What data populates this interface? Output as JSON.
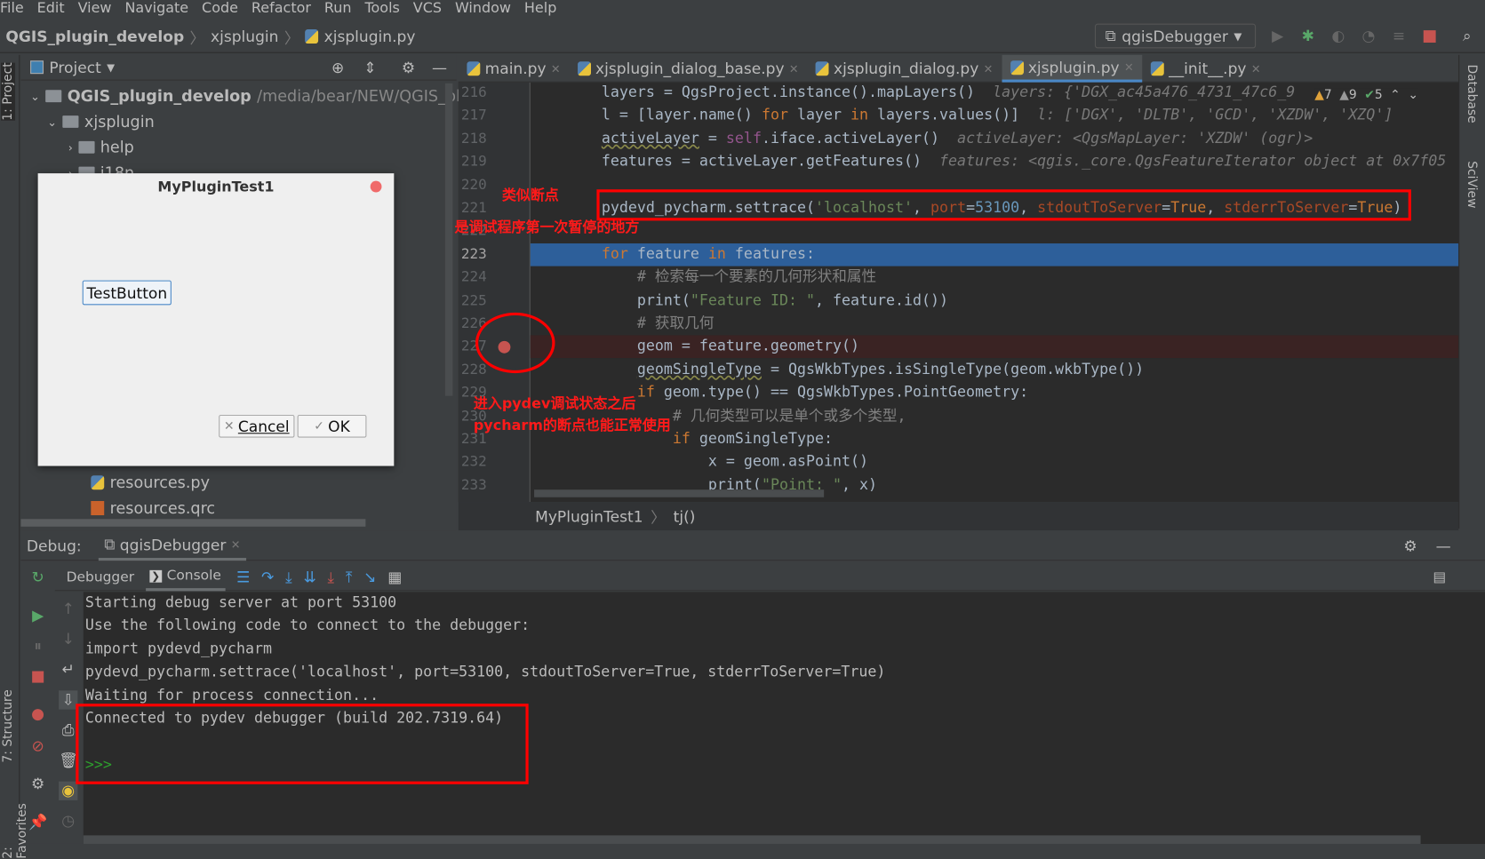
{
  "menu": [
    "File",
    "Edit",
    "View",
    "Navigate",
    "Code",
    "Refactor",
    "Run",
    "Tools",
    "VCS",
    "Window",
    "Help"
  ],
  "breadcrumb": {
    "project": "QGIS_plugin_develop",
    "folder": "xjsplugin",
    "file": "xjsplugin.py"
  },
  "run_config": "qgisDebugger",
  "left_strip": {
    "project": "1: Project",
    "structure": "7: Structure",
    "favorites": "2: Favorites"
  },
  "right_strip": {
    "database": "Database",
    "sciview": "SciView"
  },
  "project_panel": {
    "title": "Project",
    "root": "QGIS_plugin_develop",
    "root_path": "/media/bear/NEW/QGIS_plugi",
    "items": [
      "xjsplugin",
      "help",
      "i18n",
      "resources.py",
      "resources.qrc"
    ]
  },
  "dialog": {
    "title": "MyPluginTest1",
    "test_button": "TestButton",
    "cancel": "Cancel",
    "ok": "OK"
  },
  "tabs": [
    {
      "label": "main.py"
    },
    {
      "label": "xjsplugin_dialog_base.py"
    },
    {
      "label": "xjsplugin_dialog.py"
    },
    {
      "label": "xjsplugin.py",
      "active": true
    },
    {
      "label": "__init__.py"
    }
  ],
  "inspections": {
    "warnings": "7",
    "weak_warnings": "9",
    "ok": "5"
  },
  "code": [
    {
      "n": "216",
      "tokens": [
        [
          "",
          "        layers = QgsProject.instance().mapLayers()  "
        ],
        [
          "hint",
          "layers: {'DGX_ac45a476_4731_47c6_9"
        ]
      ]
    },
    {
      "n": "217",
      "tokens": [
        [
          "",
          "        l = [layer.name() "
        ],
        [
          "kw",
          "for"
        ],
        [
          "",
          " layer "
        ],
        [
          "kw",
          "in"
        ],
        [
          "",
          " layers.values()]  "
        ],
        [
          "hint",
          "l: ['DGX', 'DLTB', 'GCD', 'XZDW', 'XZQ']"
        ]
      ]
    },
    {
      "n": "218",
      "tokens": [
        [
          "",
          "        "
        ],
        [
          "ul",
          "activeLayer"
        ],
        [
          "",
          " = "
        ],
        [
          "self",
          "self"
        ],
        [
          "",
          ".iface.activeLayer()  "
        ],
        [
          "hint",
          "activeLayer: <QgsMapLayer: 'XZDW' (ogr)>"
        ]
      ]
    },
    {
      "n": "219",
      "tokens": [
        [
          "",
          "        features = activeLayer.getFeatures()  "
        ],
        [
          "hint",
          "features: <qgis._core.QgsFeatureIterator object at 0x7f05"
        ]
      ]
    },
    {
      "n": "220",
      "tokens": []
    },
    {
      "n": "221",
      "tokens": [
        [
          "",
          "        pydevd_pycharm.settrace("
        ],
        [
          "str",
          "'localhost'"
        ],
        [
          "",
          ", "
        ],
        [
          "param",
          "port"
        ],
        [
          "",
          "="
        ],
        [
          "num",
          "53100"
        ],
        [
          "",
          ", "
        ],
        [
          "param",
          "stdoutToServer"
        ],
        [
          "",
          "="
        ],
        [
          "kw",
          "True"
        ],
        [
          "",
          ", "
        ],
        [
          "param",
          "stderrToServer"
        ],
        [
          "",
          "="
        ],
        [
          "kw",
          "True"
        ],
        [
          "",
          ")"
        ]
      ]
    },
    {
      "n": "222",
      "tokens": []
    },
    {
      "n": "223",
      "tokens": [
        [
          "",
          "        "
        ],
        [
          "kw",
          "for"
        ],
        [
          "",
          " feature "
        ],
        [
          "kw",
          "in"
        ],
        [
          "",
          " features:"
        ]
      ],
      "current": true
    },
    {
      "n": "224",
      "tokens": [
        [
          "com",
          "            # 检索每一个要素的几何形状和属性"
        ]
      ]
    },
    {
      "n": "225",
      "tokens": [
        [
          "",
          "            print("
        ],
        [
          "str",
          "\"Feature ID: \""
        ],
        [
          "",
          ", feature.id())"
        ]
      ]
    },
    {
      "n": "226",
      "tokens": [
        [
          "com",
          "            # 获取几何"
        ]
      ]
    },
    {
      "n": "227",
      "tokens": [
        [
          "",
          "            geom = feature.geometry()"
        ]
      ],
      "breakpoint": true
    },
    {
      "n": "228",
      "tokens": [
        [
          "",
          "            "
        ],
        [
          "ul",
          "geomSingleType"
        ],
        [
          "",
          " = QgsWkbTypes.isSingleType(geom.wkbType())"
        ]
      ]
    },
    {
      "n": "229",
      "tokens": [
        [
          "",
          "            "
        ],
        [
          "kw",
          "if"
        ],
        [
          "",
          " geom.type() == QgsWkbTypes.PointGeometry:"
        ]
      ]
    },
    {
      "n": "230",
      "tokens": [
        [
          "com",
          "                # 几何类型可以是单个或多个类型,"
        ]
      ]
    },
    {
      "n": "231",
      "tokens": [
        [
          "",
          "                "
        ],
        [
          "kw",
          "if"
        ],
        [
          "",
          " geomSingleType:"
        ]
      ]
    },
    {
      "n": "232",
      "tokens": [
        [
          "",
          "                    x = geom.asPoint()"
        ]
      ]
    },
    {
      "n": "233",
      "tokens": [
        [
          "",
          "                    print("
        ],
        [
          "str",
          "\"Point: \""
        ],
        [
          "",
          ", x)"
        ]
      ]
    }
  ],
  "editor_breadcrumb": [
    "MyPluginTest1",
    "tj()"
  ],
  "debug": {
    "label": "Debug:",
    "session": "qgisDebugger",
    "tabs": [
      "Debugger",
      "Console"
    ]
  },
  "console": [
    "Starting debug server at port 53100",
    "Use the following code to connect to the debugger:",
    "import pydevd_pycharm",
    "pydevd_pycharm.settrace('localhost', port=53100, stdoutToServer=True, stderrToServer=True)",
    "Waiting for process connection...",
    "Connected to pydev debugger (build 202.7319.64)"
  ],
  "prompt": ">>>",
  "annotations": {
    "a1": "类似断点",
    "a2": "是调试程序第一次暂停的地方",
    "a3": "进入pydev调试状态之后",
    "a4": "pycharm的断点也能正常使用"
  },
  "colors": {
    "annotation": "#ff0000",
    "current_line": "#2d5f9a",
    "breakpoint": "#c75450",
    "editor_bg": "#2b2b2b"
  }
}
